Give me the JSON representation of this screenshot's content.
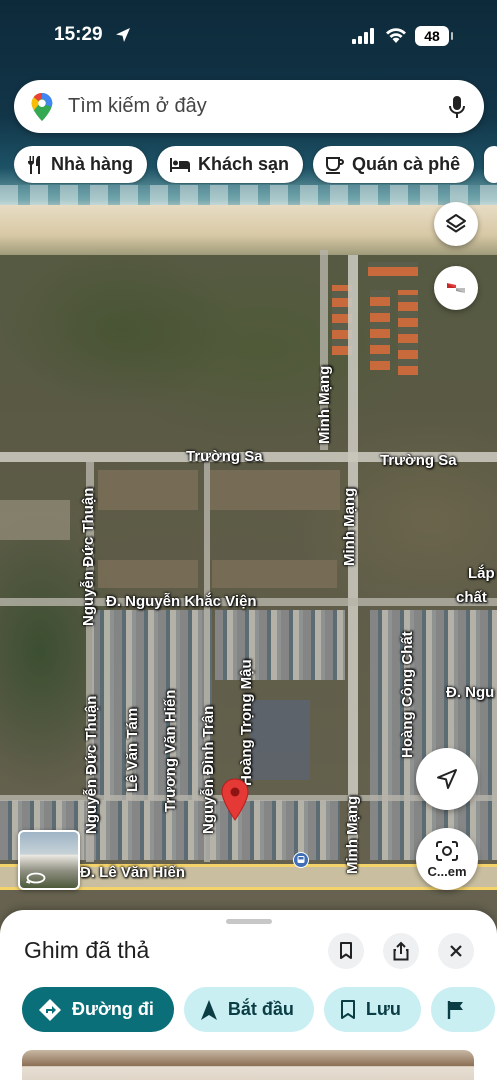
{
  "status_bar": {
    "time": "15:29",
    "battery": "48"
  },
  "search": {
    "placeholder": "Tìm kiếm ở đây"
  },
  "chips": [
    {
      "label": "Nhà hàng",
      "icon": "restaurant-icon"
    },
    {
      "label": "Khách sạn",
      "icon": "hotel-icon"
    },
    {
      "label": "Quán cà phê",
      "icon": "coffee-icon"
    }
  ],
  "map_labels": {
    "truong_sa_1": "Trường Sa",
    "truong_sa_2": "Trường Sa",
    "minh_mang_top": "Minh Mạng",
    "minh_mang_mid": "Minh Mạng",
    "minh_mang_bottom": "Minh Mạng",
    "nguyen_duc_thuan_top": "Nguyễn Đức Thuận",
    "nguyen_duc_thuan_bottom": "Nguyễn Đức Thuận",
    "nguyen_khac_vien": "Đ. Nguyễn Khắc Viện",
    "hoang_trong_mau": "Hoàng Trọng Mậu",
    "le_van_tam": "Lê Văn Tám",
    "truong_van_hien": "Trương Văn Hiến",
    "nguyen_dinh_tran": "Nguyễn Đình Trân",
    "hoang_cong_chat": "Hoàng Công Chất",
    "d_ngu": "Đ. Ngu",
    "lap": "Lắp",
    "chat": "chất",
    "le_van_hien": "Đ. Lê Văn Hiến"
  },
  "lens_button": {
    "label": "C...em"
  },
  "sheet": {
    "title": "Ghim đã thả",
    "actions": [
      {
        "label": "Đường đi",
        "icon": "directions-icon",
        "style": "primary"
      },
      {
        "label": "Bắt đầu",
        "icon": "navigation-arrow-icon",
        "style": "secondary"
      },
      {
        "label": "Lưu",
        "icon": "bookmark-icon",
        "style": "secondary"
      },
      {
        "label": "",
        "icon": "flag-icon",
        "style": "secondary"
      }
    ]
  },
  "colors": {
    "primary_action": "#0b6f79",
    "secondary_action": "#c9eff3",
    "pin": "#e53935"
  }
}
